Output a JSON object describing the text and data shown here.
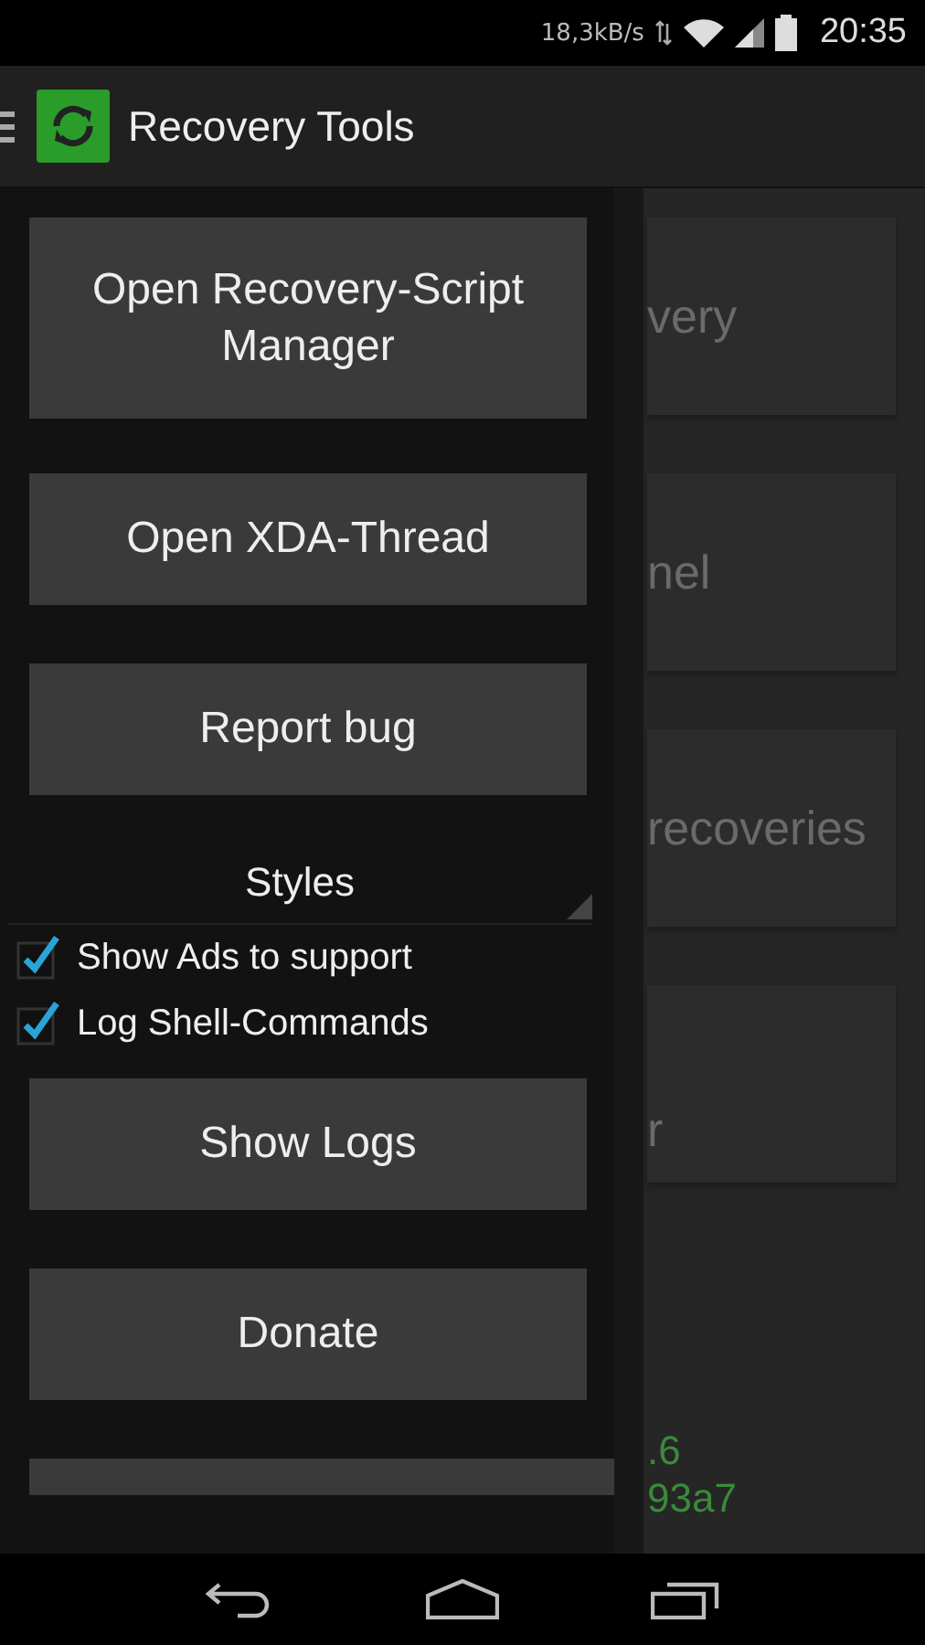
{
  "status_bar": {
    "speed": "18,3kB/s",
    "time": "20:35"
  },
  "app_bar": {
    "title": "Recovery Tools"
  },
  "background_cards": [
    {
      "text": "very"
    },
    {
      "text": "nel"
    },
    {
      "text": "recoveries"
    },
    {
      "text": "r"
    }
  ],
  "background_info": [
    ".6",
    "93a7"
  ],
  "drawer": {
    "top_buttons": [
      {
        "label": "Open Recovery-Script Manager",
        "kind": "tall"
      },
      {
        "label": "Open XDA-Thread",
        "kind": "normal"
      },
      {
        "label": "Report bug",
        "kind": "normal"
      }
    ],
    "styles_spinner": "Styles",
    "options": [
      {
        "label": "Show Ads to support",
        "checked": true
      },
      {
        "label": "Log Shell-Commands",
        "checked": true
      }
    ],
    "bottom_buttons": [
      {
        "label": "Show Logs",
        "kind": "normal"
      },
      {
        "label": "Donate",
        "kind": "normal"
      }
    ]
  }
}
